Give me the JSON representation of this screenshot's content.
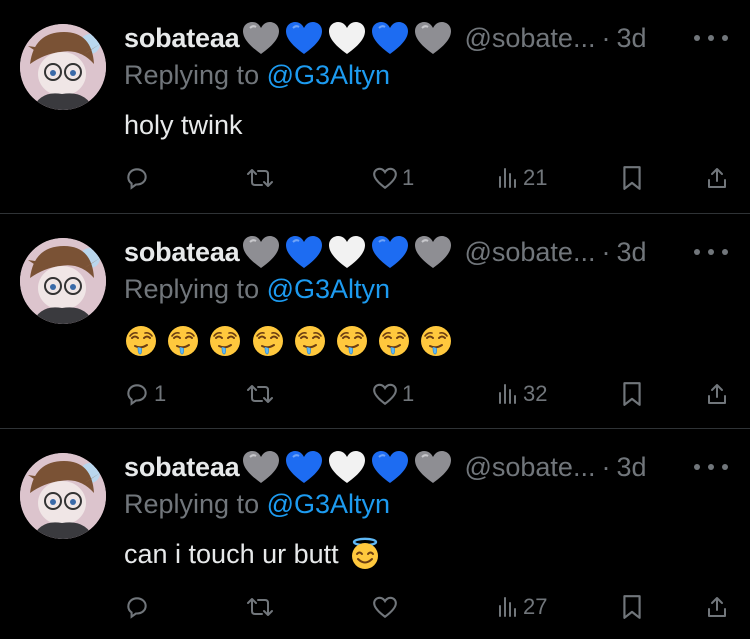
{
  "tweets": [
    {
      "name": "sobateaa",
      "handle": "@sobate...",
      "dot": "·",
      "time": "3d",
      "replying_prefix": "Replying to ",
      "replying_to": "@G3Altyn",
      "text": "holy twink",
      "emoji_count": 0,
      "trailing_emoji": "",
      "counts": {
        "reply": "",
        "retweet": "",
        "like": "1",
        "views": "21"
      }
    },
    {
      "name": "sobateaa",
      "handle": "@sobate...",
      "dot": "·",
      "time": "3d",
      "replying_prefix": "Replying to ",
      "replying_to": "@G3Altyn",
      "text": "",
      "emoji_count": 8,
      "trailing_emoji": "drooling-face",
      "counts": {
        "reply": "1",
        "retweet": "",
        "like": "1",
        "views": "32"
      }
    },
    {
      "name": "sobateaa",
      "handle": "@sobate...",
      "dot": "·",
      "time": "3d",
      "replying_prefix": "Replying to ",
      "replying_to": "@G3Altyn",
      "text": "can i touch ur butt ",
      "emoji_count": 1,
      "trailing_emoji": "smiling-face-with-halo",
      "counts": {
        "reply": "",
        "retweet": "",
        "like": "",
        "views": "27"
      }
    }
  ],
  "name_hearts": [
    "grey-heart",
    "blue-heart",
    "white-heart",
    "blue-heart",
    "grey-heart"
  ],
  "colors": {
    "background": "#000000",
    "text": "#e7e9ea",
    "muted": "#71767b",
    "link": "#1d9bf0",
    "divider": "#2f3336",
    "blue_heart": "#1d6cf2",
    "grey_heart": "#8e8e93",
    "white_heart": "#f2f2f2"
  }
}
